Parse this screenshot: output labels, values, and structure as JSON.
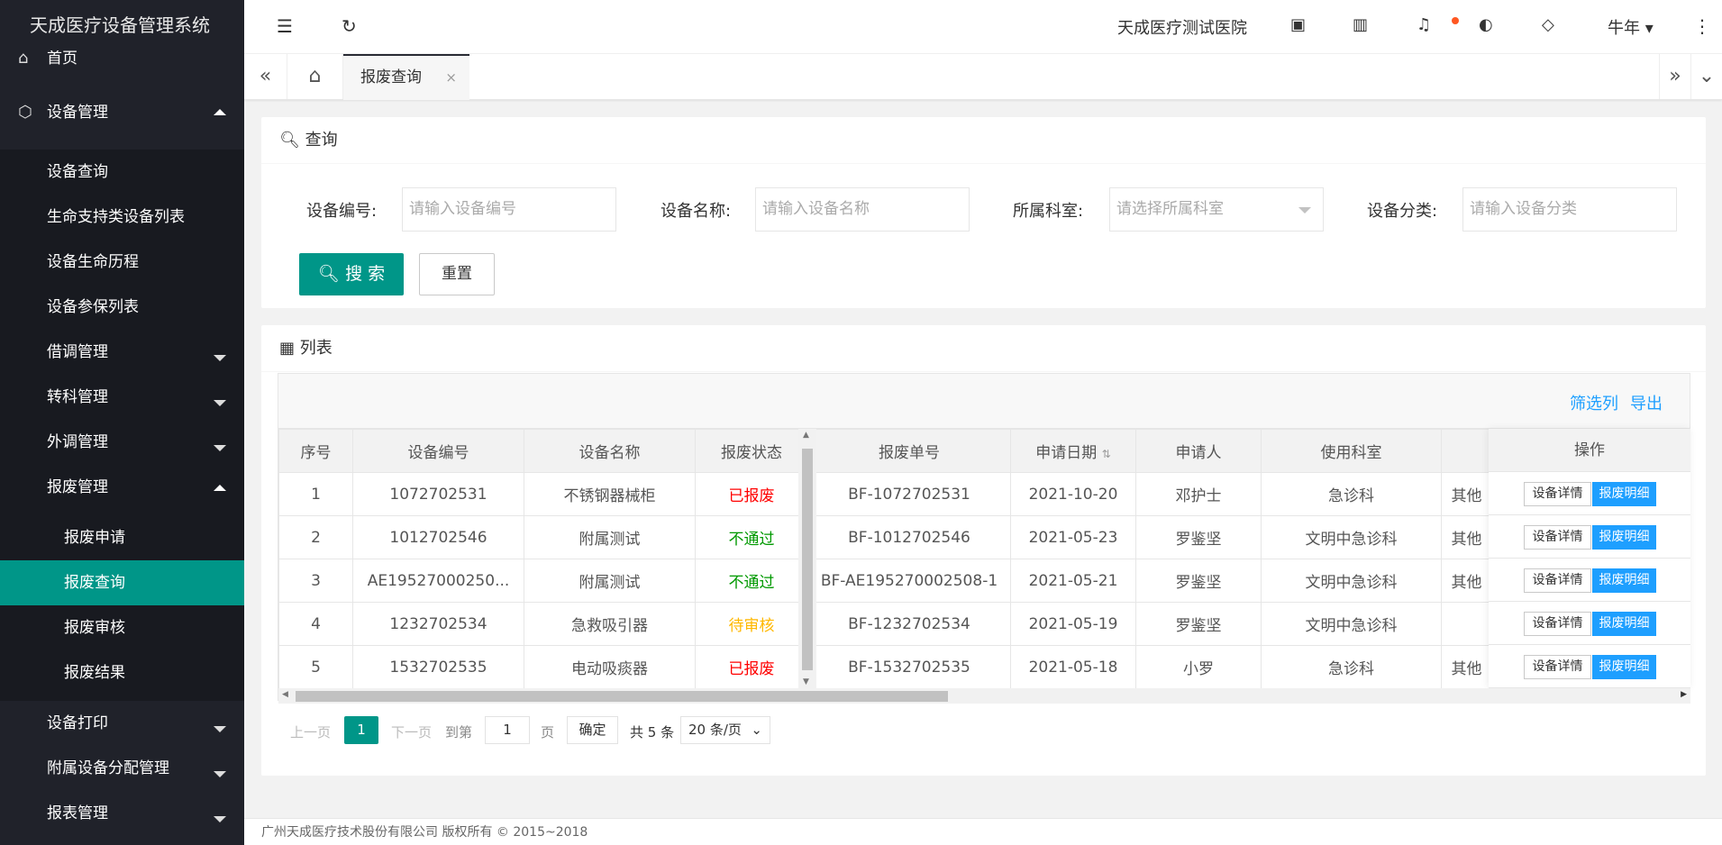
{
  "app": {
    "title": "天成医疗设备管理系统"
  },
  "sidebar": {
    "home": "首页",
    "device_mgmt": "设备管理",
    "device_sub": [
      "设备查询",
      "生命支持类设备列表",
      "设备生命历程",
      "设备参保列表"
    ],
    "groups": [
      "借调管理",
      "转科管理",
      "外调管理"
    ],
    "scrap_mgmt": "报废管理",
    "scrap_sub": [
      "报废申请",
      "报废查询",
      "报废审核",
      "报废结果"
    ],
    "bottom": [
      "设备打印",
      "附属设备分配管理",
      "报表管理"
    ]
  },
  "header": {
    "hospital": "天成医疗测试医院",
    "user": "牛年"
  },
  "tabs": {
    "active": "报废查询"
  },
  "query": {
    "title": "查询",
    "fields": [
      {
        "label": "设备编号:",
        "placeholder": "请输入设备编号"
      },
      {
        "label": "设备名称:",
        "placeholder": "请输入设备名称"
      },
      {
        "label": "所属科室:",
        "placeholder": "请选择所属科室"
      },
      {
        "label": "设备分类:",
        "placeholder": "请输入设备分类"
      }
    ],
    "search": "搜 索",
    "reset": "重置"
  },
  "list": {
    "title": "列表",
    "filter": "筛选列",
    "export": "导出",
    "headers": [
      "序号",
      "设备编号",
      "设备名称",
      "报废状态",
      "报废单号",
      "申请日期",
      "申请人",
      "使用科室",
      "",
      "操作"
    ],
    "rows": [
      {
        "no": "1",
        "code": "1072702531",
        "name": "不锈钢器械柜",
        "status": "已报废",
        "order": "BF-1072702531",
        "date": "2021-10-20",
        "applicant": "邓护士",
        "dept": "急诊科",
        "extra": "其他"
      },
      {
        "no": "2",
        "code": "1012702546",
        "name": "附属测试",
        "status": "不通过",
        "order": "BF-1012702546",
        "date": "2021-05-23",
        "applicant": "罗鉴坚",
        "dept": "文明中急诊科",
        "extra": "其他"
      },
      {
        "no": "3",
        "code": "AE19527000250...",
        "name": "附属测试",
        "status": "不通过",
        "order": "BF-AE195270002508-1",
        "date": "2021-05-21",
        "applicant": "罗鉴坚",
        "dept": "文明中急诊科",
        "extra": "其他"
      },
      {
        "no": "4",
        "code": "1232702534",
        "name": "急救吸引器",
        "status": "待审核",
        "order": "BF-1232702534",
        "date": "2021-05-19",
        "applicant": "罗鉴坚",
        "dept": "文明中急诊科",
        "extra": ""
      },
      {
        "no": "5",
        "code": "1532702535",
        "name": "电动吸痰器",
        "status": "已报废",
        "order": "BF-1532702535",
        "date": "2021-05-18",
        "applicant": "小罗",
        "dept": "急诊科",
        "extra": "其他"
      }
    ],
    "btn_detail": "设备详情",
    "btn_scrap": "报废明细"
  },
  "pager": {
    "prev": "上一页",
    "current": "1",
    "next": "下一页",
    "goto": "到第",
    "page_input": "1",
    "page": "页",
    "confirm": "确定",
    "total": "共 5 条",
    "per_page": "20 条/页"
  },
  "footer": "广州天成医疗技术股份有限公司 版权所有 © 2015~2018",
  "colors": {
    "primary": "#009688",
    "blue": "#1e9fff",
    "sidebar": "#20222a",
    "red": "#ff0000",
    "green": "#009900",
    "orange": "#ffb800"
  }
}
